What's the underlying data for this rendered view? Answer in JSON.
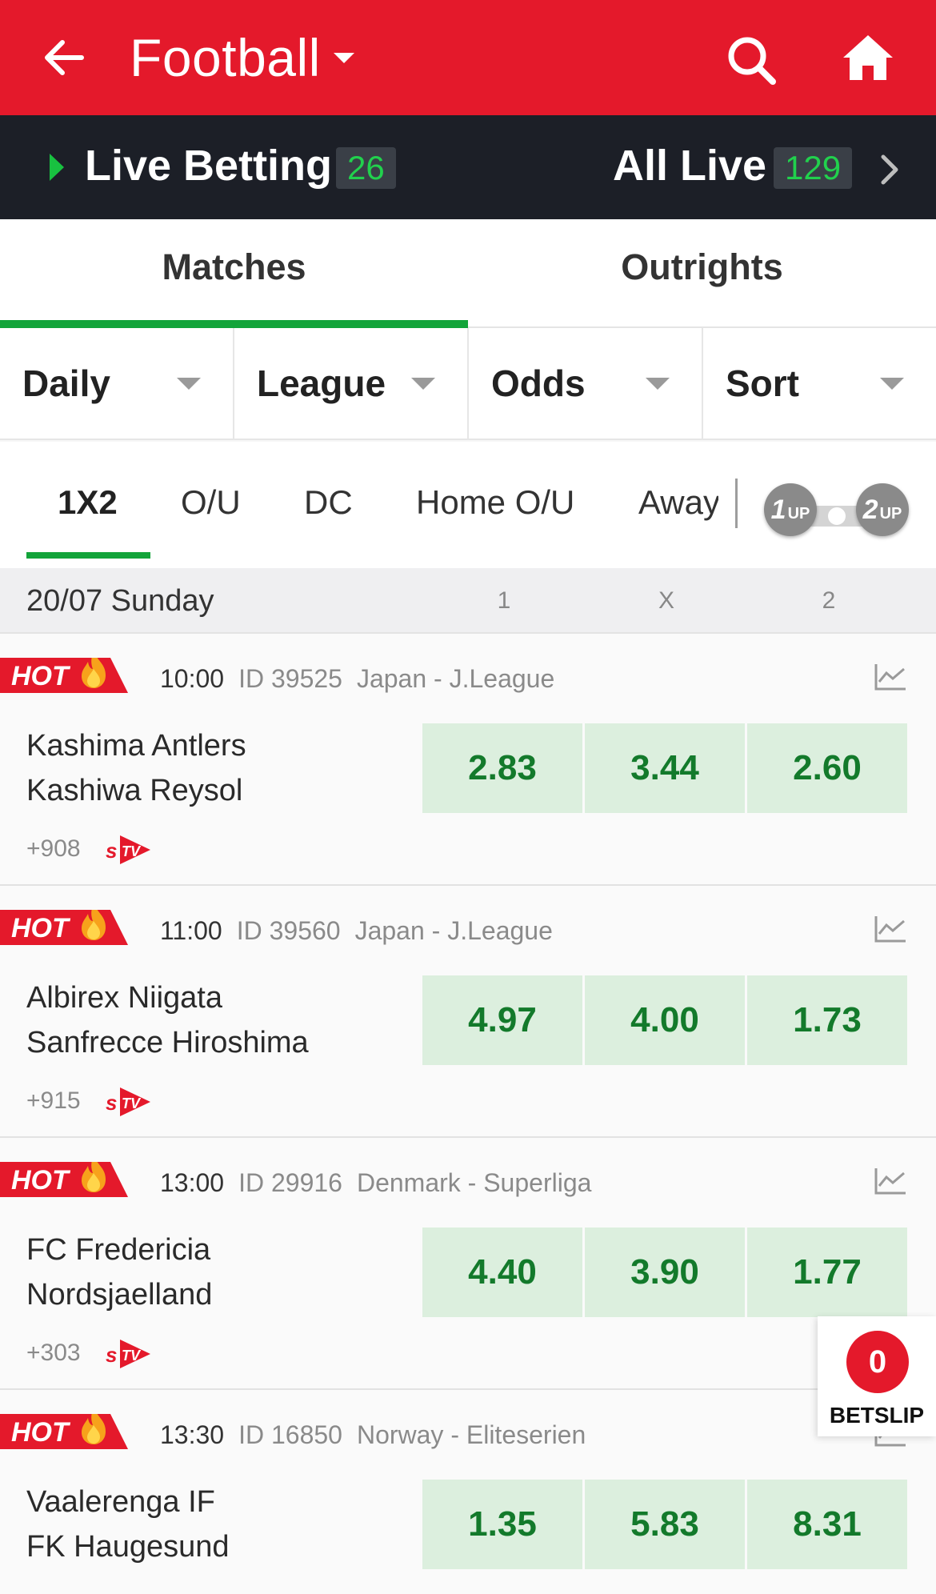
{
  "header": {
    "title": "Football",
    "icons": [
      "arrow-left-icon",
      "chevron-down-icon",
      "search-icon",
      "home-icon"
    ]
  },
  "live_bar": {
    "live_label": "Live Betting",
    "live_count": "26",
    "all_label": "All Live",
    "all_count": "129"
  },
  "tabs": [
    {
      "label": "Matches",
      "active": true
    },
    {
      "label": "Outrights",
      "active": false
    }
  ],
  "filters": [
    {
      "label": "Daily"
    },
    {
      "label": "League"
    },
    {
      "label": "Odds"
    },
    {
      "label": "Sort"
    }
  ],
  "markets": {
    "items": [
      "1X2",
      "O/U",
      "DC",
      "Home O/U",
      "Away"
    ],
    "active": "1X2",
    "toggle_1": "1",
    "toggle_1_sub": "UP",
    "toggle_2": "2",
    "toggle_2_sub": "UP"
  },
  "date_header": {
    "date": "20/07 Sunday",
    "cols": [
      "1",
      "X",
      "2"
    ]
  },
  "matches": [
    {
      "badge": "HOT",
      "time": "10:00",
      "id": "ID 39525",
      "league": "Japan - J.League",
      "home": "Kashima Antlers",
      "away": "Kashiwa Reysol",
      "more": "+908",
      "odds": [
        "2.83",
        "3.44",
        "2.60"
      ]
    },
    {
      "badge": "HOT",
      "time": "11:00",
      "id": "ID 39560",
      "league": "Japan - J.League",
      "home": "Albirex Niigata",
      "away": "Sanfrecce Hiroshima",
      "more": "+915",
      "odds": [
        "4.97",
        "4.00",
        "1.73"
      ]
    },
    {
      "badge": "HOT",
      "time": "13:00",
      "id": "ID 29916",
      "league": "Denmark - Superliga",
      "home": "FC Fredericia",
      "away": "Nordsjaelland",
      "more": "+303",
      "odds": [
        "4.40",
        "3.90",
        "1.77"
      ]
    },
    {
      "badge": "HOT",
      "time": "13:30",
      "id": "ID 16850",
      "league": "Norway - Eliteserien",
      "home": "Vaalerenga IF",
      "away": "FK Haugesund",
      "more": "",
      "odds": [
        "1.35",
        "5.83",
        "8.31"
      ]
    }
  ],
  "betslip": {
    "count": "0",
    "label": "BETSLIP"
  },
  "colors": {
    "brand_red": "#e4192b",
    "live_bar": "#1c1f27",
    "accent_green": "#13a43a",
    "odds_bg": "#dcefde",
    "odds_text": "#137a2b"
  }
}
